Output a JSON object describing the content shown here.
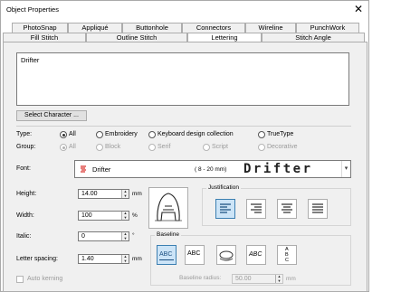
{
  "window": {
    "title": "Object Properties",
    "close_glyph": "✕"
  },
  "tabs_row1": [
    {
      "label": "PhotoSnap"
    },
    {
      "label": "Appliqué"
    },
    {
      "label": "Buttonhole"
    },
    {
      "label": "Connectors"
    },
    {
      "label": "Wireline"
    },
    {
      "label": "PunchWork"
    }
  ],
  "tabs_row2": [
    {
      "label": "Fill Stitch"
    },
    {
      "label": "Outline Stitch"
    },
    {
      "label": "Lettering",
      "active": true
    },
    {
      "label": "Stitch Angle"
    }
  ],
  "text": {
    "value": "Drifter"
  },
  "select_character": {
    "label": "Select Character ..."
  },
  "type": {
    "label": "Type:",
    "options": [
      {
        "label": "All",
        "selected": true
      },
      {
        "label": "Embroidery"
      },
      {
        "label": "Keyboard design collection"
      },
      {
        "label": "TrueType"
      }
    ]
  },
  "group": {
    "label": "Group:",
    "options": [
      {
        "label": "All",
        "selected": true
      },
      {
        "label": "Block"
      },
      {
        "label": "Serif"
      },
      {
        "label": "Script"
      },
      {
        "label": "Decorative"
      }
    ]
  },
  "font": {
    "label": "Font:",
    "name": "Drifter",
    "range": "( 8 -  20 mm)",
    "preview": "Drifter",
    "icon": "embroidery-font-icon",
    "dropdown_glyph": "▾"
  },
  "height": {
    "label": "Height:",
    "value": "14.00",
    "unit": "mm"
  },
  "width": {
    "label": "Width:",
    "value": "100",
    "unit": "%"
  },
  "italic": {
    "label": "Italic:",
    "value": "0",
    "unit": "°"
  },
  "letter_spacing": {
    "label": "Letter spacing:",
    "value": "1.40",
    "unit": "mm"
  },
  "auto_kerning": {
    "label": "Auto kerning",
    "checked": false
  },
  "justification": {
    "label": "Justification",
    "buttons": [
      "align-left-icon",
      "align-right-icon",
      "align-center-icon",
      "align-justify-icon"
    ],
    "selected_index": 0
  },
  "baseline": {
    "label": "Baseline",
    "buttons": [
      {
        "icon": "baseline-straight-icon",
        "text": "ABC"
      },
      {
        "icon": "baseline-freehand-icon",
        "text": "ABC"
      },
      {
        "icon": "baseline-circle-icon",
        "text": ""
      },
      {
        "icon": "baseline-arc-icon",
        "text": "ABC"
      },
      {
        "icon": "baseline-vertical-icon",
        "text": "A B C"
      }
    ],
    "selected_index": 0,
    "radius_label": "Baseline radius:",
    "radius_value": "50.00",
    "radius_unit": "mm"
  },
  "colors": {
    "selected_fill": "#cce4f7",
    "selected_border": "#3c7fb1",
    "font_icon_red": "#d9302c"
  }
}
